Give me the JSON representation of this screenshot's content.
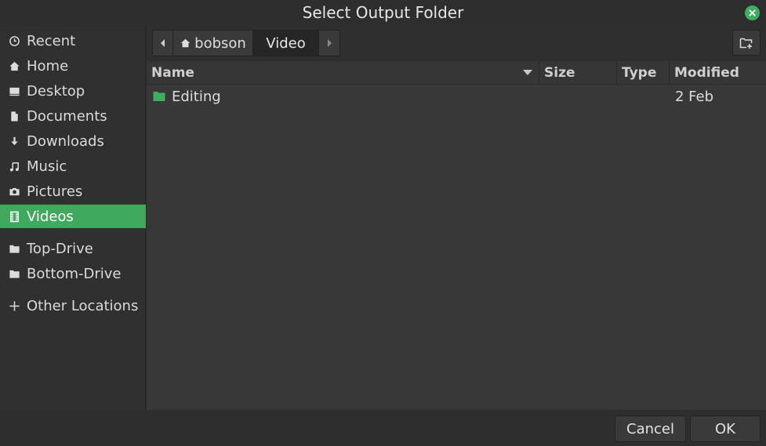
{
  "window": {
    "title": "Select Output Folder",
    "close_icon": "close-icon"
  },
  "sidebar": {
    "items": [
      {
        "label": "Recent",
        "icon": "clock-icon"
      },
      {
        "label": "Home",
        "icon": "home-icon"
      },
      {
        "label": "Desktop",
        "icon": "desktop-icon"
      },
      {
        "label": "Documents",
        "icon": "document-icon"
      },
      {
        "label": "Downloads",
        "icon": "download-icon"
      },
      {
        "label": "Music",
        "icon": "music-icon"
      },
      {
        "label": "Pictures",
        "icon": "camera-icon"
      },
      {
        "label": "Videos",
        "icon": "film-icon",
        "active": true
      },
      {
        "label": "Top-Drive",
        "icon": "folder-icon"
      },
      {
        "label": "Bottom-Drive",
        "icon": "folder-icon"
      },
      {
        "label": "Other Locations",
        "icon": "plus-icon"
      }
    ]
  },
  "pathbar": {
    "crumbs": [
      "bobson",
      "Video"
    ],
    "current": "Video"
  },
  "columns": {
    "name": "Name",
    "size": "Size",
    "type": "Type",
    "modified": "Modified"
  },
  "files": [
    {
      "name": "Editing",
      "size": "",
      "type": "",
      "modified": "2 Feb",
      "icon": "folder-icon"
    }
  ],
  "footer": {
    "cancel_label": "Cancel",
    "ok_label": "OK"
  },
  "colors": {
    "accent": "#3fa95d",
    "folder": "#3fae62",
    "background": "#383838",
    "sidebar": "#303030"
  }
}
